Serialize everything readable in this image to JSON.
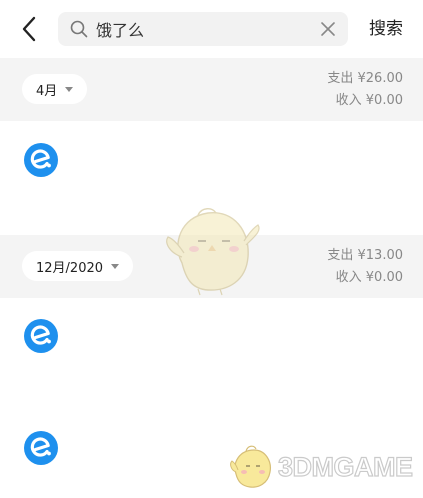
{
  "search": {
    "value": "饿了么",
    "button_label": "搜索"
  },
  "groups": [
    {
      "month": "4月",
      "expense": "支出 ¥26.00",
      "income": "收入 ¥0.00",
      "entries": [
        {
          "icon": "eleme-icon"
        }
      ]
    },
    {
      "month": "12月/2020",
      "expense": "支出 ¥13.00",
      "income": "收入 ¥0.00",
      "entries": [
        {
          "icon": "eleme-icon"
        },
        {
          "icon": "eleme-icon"
        }
      ]
    }
  ],
  "watermark": {
    "text": "3DMGAME"
  },
  "colors": {
    "accent": "#1e90ee",
    "header_bg": "#f4f4f4",
    "muted_text": "#888888"
  }
}
